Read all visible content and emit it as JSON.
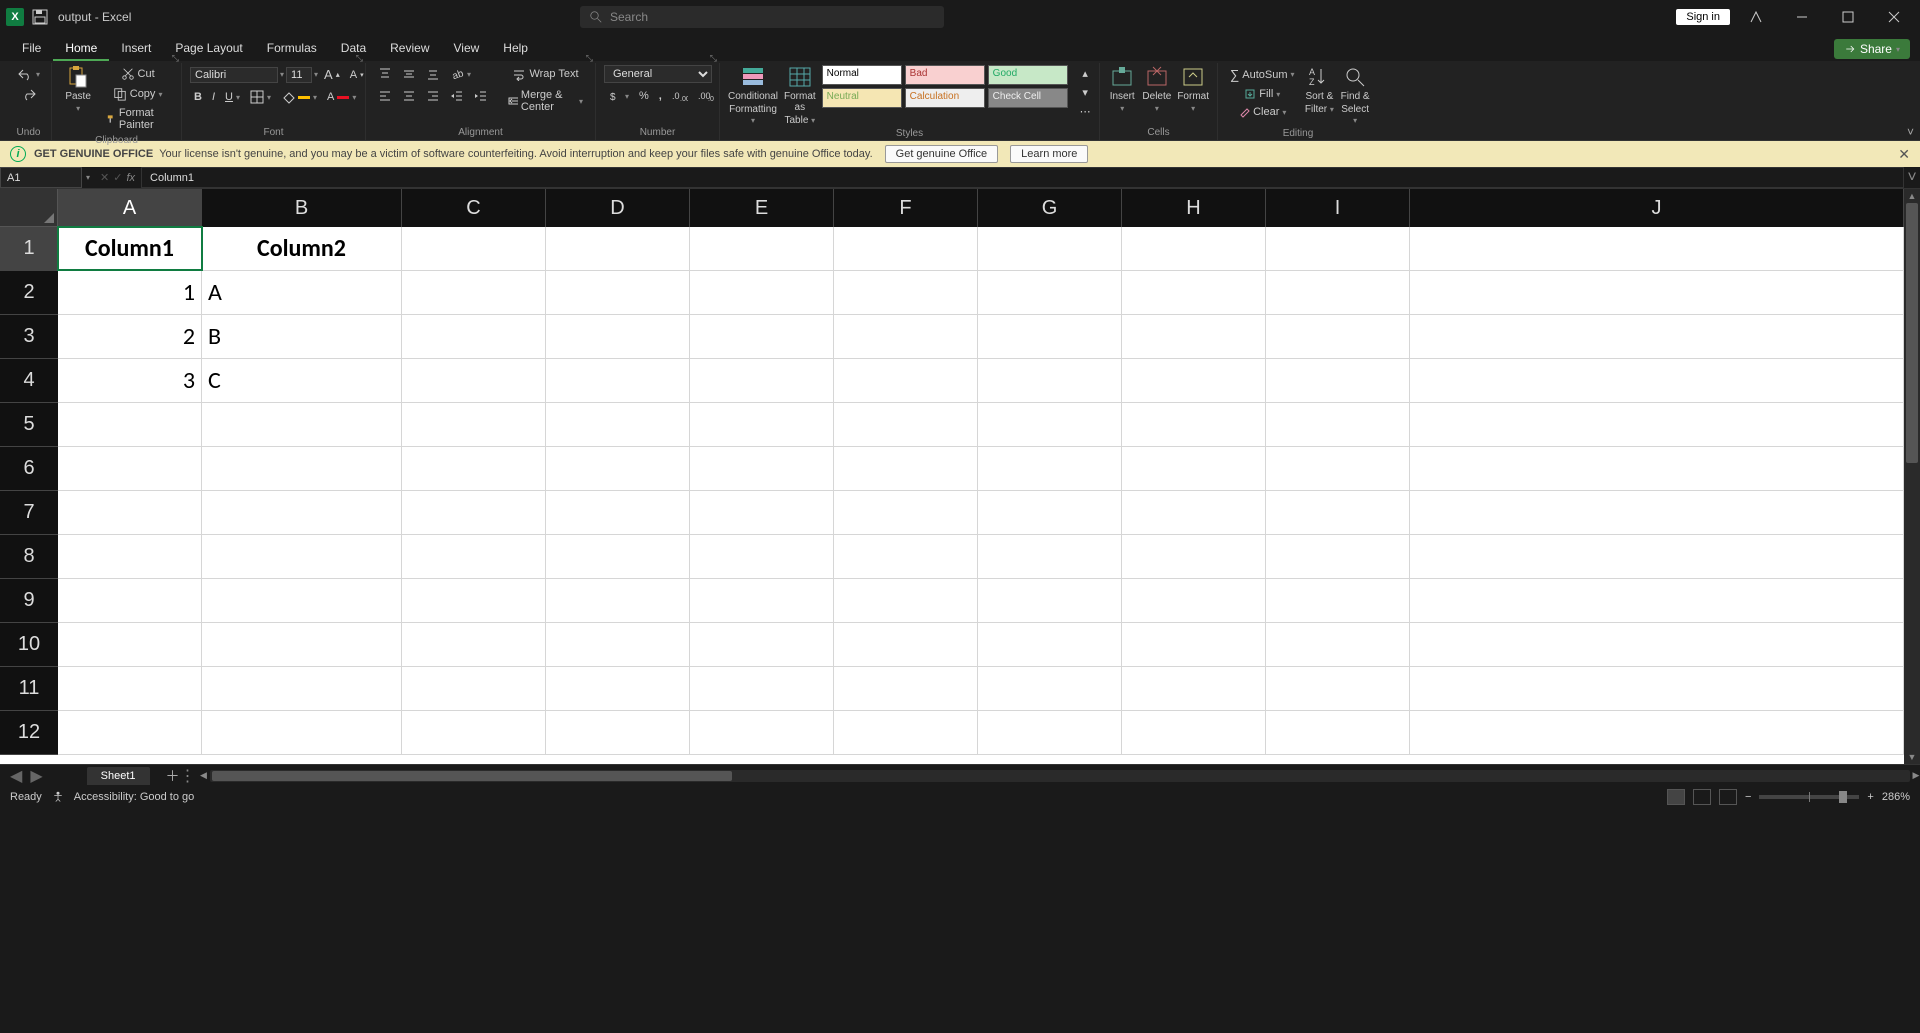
{
  "title": "output  -  Excel",
  "search_placeholder": "Search",
  "signin": "Sign in",
  "tabs": [
    "File",
    "Home",
    "Insert",
    "Page Layout",
    "Formulas",
    "Data",
    "Review",
    "View",
    "Help"
  ],
  "active_tab": "Home",
  "share": "Share",
  "ribbon": {
    "undo": "Undo",
    "paste": "Paste",
    "cut": "Cut",
    "copy": "Copy",
    "format_painter": "Format Painter",
    "clipboard": "Clipboard",
    "font_name": "Calibri",
    "font_size": "11",
    "font": "Font",
    "wrap": "Wrap Text",
    "merge": "Merge & Center",
    "alignment": "Alignment",
    "num_format": "General",
    "number": "Number",
    "cond_fmt_l1": "Conditional",
    "cond_fmt_l2": "Formatting",
    "fmt_table_l1": "Format as",
    "fmt_table_l2": "Table",
    "styles_lbl": "Styles",
    "styles": {
      "normal": "Normal",
      "bad": "Bad",
      "good": "Good",
      "neutral": "Neutral",
      "calc": "Calculation",
      "check": "Check Cell"
    },
    "insert": "Insert",
    "delete": "Delete",
    "format": "Format",
    "cells": "Cells",
    "autosum": "AutoSum",
    "fill": "Fill",
    "clear": "Clear",
    "sort_l1": "Sort &",
    "sort_l2": "Filter",
    "find_l1": "Find &",
    "find_l2": "Select",
    "editing": "Editing"
  },
  "banner": {
    "title": "Get Genuine Office",
    "msg": "Your license isn't genuine, and you may be a victim of software counterfeiting. Avoid interruption and keep your files safe with genuine Office today.",
    "btn1": "Get genuine Office",
    "btn2": "Learn more"
  },
  "name_box": "A1",
  "formula": "Column1",
  "columns": [
    "A",
    "B",
    "C",
    "D",
    "E",
    "F",
    "G",
    "H",
    "I",
    "J"
  ],
  "row_count": 12,
  "grid": {
    "r1": {
      "A": "Column1",
      "B": "Column2"
    },
    "r2": {
      "A": "1",
      "B": "A"
    },
    "r3": {
      "A": "2",
      "B": "B"
    },
    "r4": {
      "A": "3",
      "B": "C"
    }
  },
  "sheet": "Sheet1",
  "status": {
    "ready": "Ready",
    "acc": "Accessibility: Good to go",
    "zoom": "286%"
  }
}
